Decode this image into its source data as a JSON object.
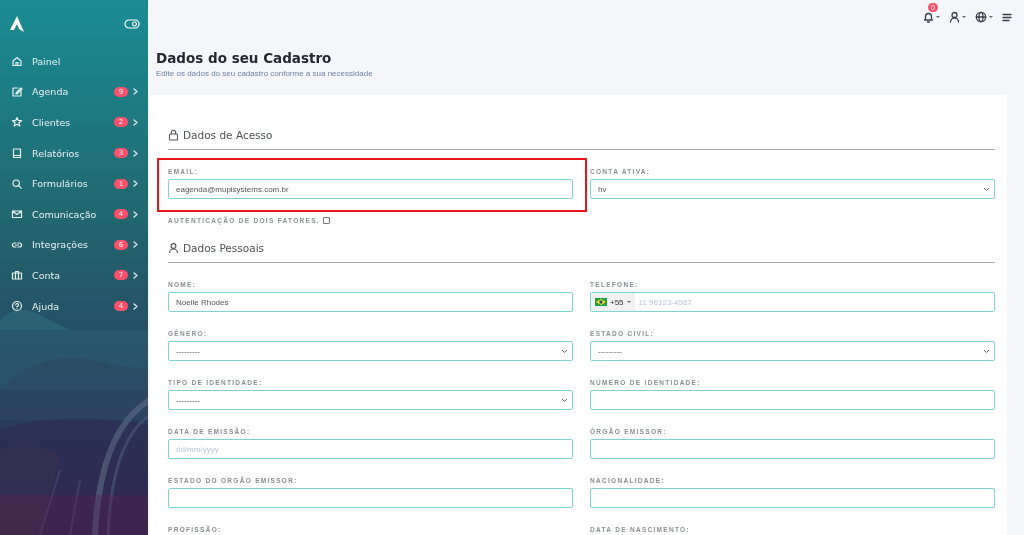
{
  "sidebar": {
    "items": [
      {
        "label": "Painel",
        "expandable": false
      },
      {
        "label": "Agenda",
        "badge": "9",
        "expandable": true
      },
      {
        "label": "Clientes",
        "badge": "2",
        "expandable": true
      },
      {
        "label": "Relatórios",
        "badge": "3",
        "expandable": true
      },
      {
        "label": "Formulários",
        "badge": "1",
        "expandable": true
      },
      {
        "label": "Comunicação",
        "badge": "4",
        "expandable": true
      },
      {
        "label": "Integrações",
        "badge": "6",
        "expandable": true
      },
      {
        "label": "Conta",
        "badge": "7",
        "expandable": true
      },
      {
        "label": "Ajuda",
        "badge": "4",
        "expandable": true
      }
    ]
  },
  "topbar": {
    "notification_count": "0"
  },
  "page": {
    "title": "Dados do seu Cadastro",
    "subtitle": "Edite os dados do seu cadastro conforme a sua necessidade"
  },
  "sections": [
    {
      "title": "Dados de Acesso",
      "fields": [
        {
          "kind": "text",
          "label": "EMAIL:",
          "value": "eagenda@mupisystems.com.br",
          "highlighted": true
        },
        {
          "kind": "select",
          "label": "CONTA ATIVA:",
          "value": "hv"
        },
        {
          "kind": "checkbox",
          "label": "AUTENTICAÇÃO DE DOIS FATORES.",
          "checked": false
        }
      ]
    },
    {
      "title": "Dados Pessoais",
      "fields": [
        {
          "kind": "text",
          "label": "NOME:",
          "value": "Noelle Rhodes"
        },
        {
          "kind": "phone",
          "label": "TELEFONE:",
          "code": "+55",
          "placeholder": "11 96123-4567"
        },
        {
          "kind": "select",
          "label": "GÊNERO:",
          "value": "---------"
        },
        {
          "kind": "select",
          "label": "ESTADO CIVIL:",
          "value": "---------"
        },
        {
          "kind": "select",
          "label": "TIPO DE IDENTIDADE:",
          "value": "---------"
        },
        {
          "kind": "text",
          "label": "NÚMERO DE IDENTIDADE:"
        },
        {
          "kind": "text",
          "label": "DATA DE EMISSÃO:",
          "placeholder": "dd/mm/yyyy"
        },
        {
          "kind": "text",
          "label": "ÓRGÃO EMISSOR:"
        },
        {
          "kind": "text",
          "label": "ESTADO DO ORGÃO EMISSOR:"
        },
        {
          "kind": "text",
          "label": "NACIONALIDADE:"
        },
        {
          "kind": "label",
          "label": "PROFISSÃO:"
        },
        {
          "kind": "label",
          "label": "DATA DE NASCIMENTO:"
        }
      ]
    }
  ]
}
